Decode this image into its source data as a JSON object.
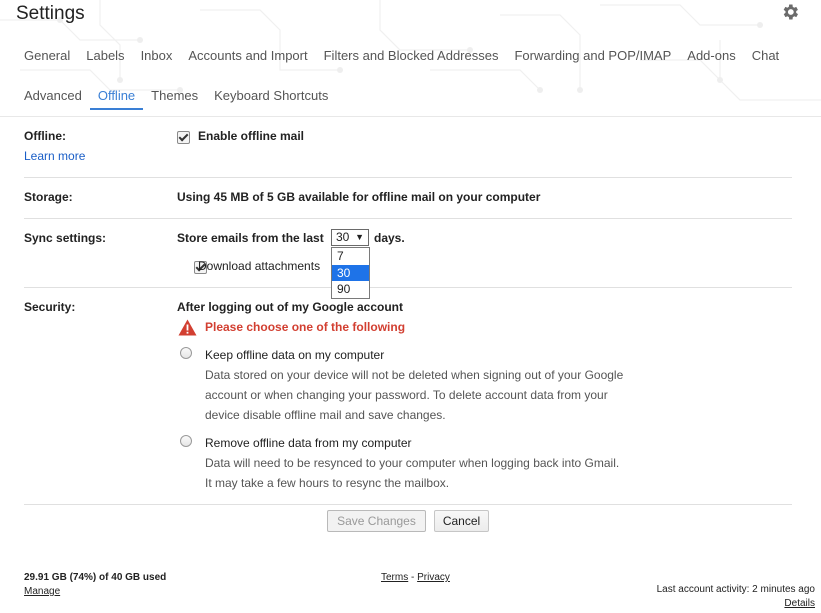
{
  "header": {
    "title": "Settings",
    "gear_icon": "gear-icon",
    "tabs_row1": [
      {
        "label": "General"
      },
      {
        "label": "Labels"
      },
      {
        "label": "Inbox"
      },
      {
        "label": "Accounts and Import"
      },
      {
        "label": "Filters and Blocked Addresses"
      },
      {
        "label": "Forwarding and POP/IMAP"
      },
      {
        "label": "Add-ons"
      },
      {
        "label": "Chat"
      }
    ],
    "tabs_row2": [
      {
        "label": "Advanced"
      },
      {
        "label": "Offline",
        "active": true
      },
      {
        "label": "Themes"
      },
      {
        "label": "Keyboard Shortcuts"
      }
    ]
  },
  "offline": {
    "label": "Offline:",
    "learn_more": "Learn more",
    "enable_label": "Enable offline mail",
    "enabled": true
  },
  "storage": {
    "label": "Storage:",
    "text": "Using 45 MB of 5 GB available for offline mail on your computer"
  },
  "sync": {
    "label": "Sync settings:",
    "prefix": "Store emails from the last",
    "selected": "30",
    "suffix": "days.",
    "options": [
      "7",
      "30",
      "90"
    ],
    "download_attachments": "Download attachments",
    "download_checked": true
  },
  "security": {
    "label": "Security:",
    "heading": "After logging out of my Google account",
    "warning": "Please choose one of the following",
    "option_keep": {
      "label": "Keep offline data on my computer",
      "desc": "Data stored on your device will not be deleted when signing out of your Google account or when changing your password. To delete account data from your device disable offline mail and save changes."
    },
    "option_remove": {
      "label": "Remove offline data from my computer",
      "desc": "Data will need to be resynced to your computer when logging back into Gmail. It may take a few hours to resync the mailbox."
    }
  },
  "buttons": {
    "save": "Save Changes",
    "cancel": "Cancel"
  },
  "footer": {
    "storage_used": "29.91 GB (74%) of 40 GB used",
    "manage": "Manage",
    "terms": "Terms",
    "separator": " - ",
    "privacy": "Privacy",
    "last_activity": "Last account activity: 2 minutes ago",
    "details": "Details"
  },
  "colors": {
    "accent": "#3a7fd5",
    "warning": "#d23f31",
    "link": "#1a5ec7"
  }
}
